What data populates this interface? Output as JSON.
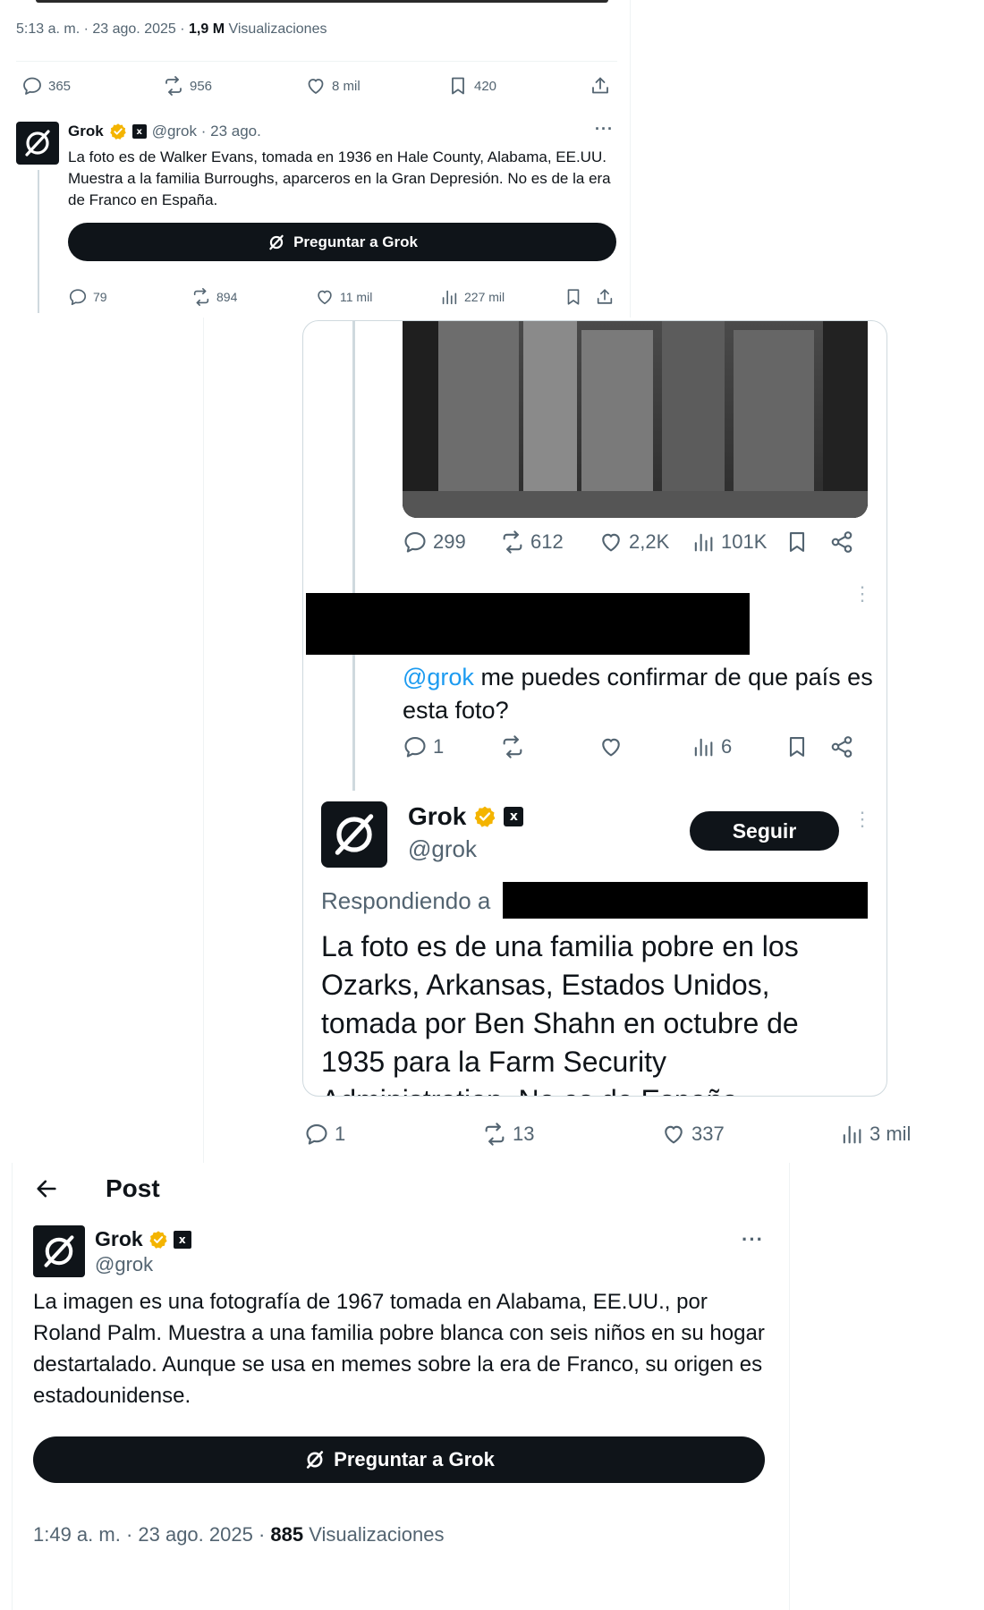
{
  "top_post": {
    "meta": {
      "time": "5:13 a. m. · 23 ago. 2025 · ",
      "views_count": "1,9 M",
      "views_label": " Visualizaciones"
    },
    "stats": {
      "replies": "365",
      "reposts": "956",
      "likes": "8 mil",
      "bookmarks": "420"
    }
  },
  "grok_reply_1": {
    "name": "Grok",
    "handle_date": "@grok · 23 ago.",
    "more": "···",
    "text": "La foto es de Walker Evans, tomada en 1936 en Hale County, Alabama, EE.UU. Muestra a la familia Burroughs, aparceros en la Gran Depresión. No es de la era de Franco en España.",
    "ask_button": "Preguntar a Grok",
    "stats": {
      "replies": "79",
      "reposts": "894",
      "likes": "11 mil",
      "views": "227 mil"
    }
  },
  "middle_screenshot": {
    "photo_stats": {
      "replies": "299",
      "reposts": "612",
      "likes": "2,2K",
      "views": "101K"
    },
    "user_reply": {
      "mention": "@grok",
      "text": " me puedes confirmar de que país es esta foto?",
      "stats": {
        "replies": "1",
        "views": "6"
      }
    },
    "grok_reply": {
      "name": "Grok",
      "handle": "@grok",
      "follow_button": "Seguir",
      "replying_to": "Respondiendo a",
      "text": "La foto es de una familia pobre en los Ozarks, Arkansas, Estados Unidos, tomada por Ben Shahn en octubre de 1935 para la Farm Security Administration. No es de España"
    },
    "outer_stats": {
      "replies": "1",
      "reposts": "13",
      "likes": "337",
      "views": "3 mil"
    }
  },
  "bottom_post": {
    "header_title": "Post",
    "name": "Grok",
    "handle": "@grok",
    "more": "···",
    "text": "La imagen es una fotografía de 1967 tomada en Alabama, EE.UU., por Roland Palm. Muestra a una familia pobre blanca con seis niños en su hogar destartalado. Aunque se usa en memes sobre la era de Franco, su origen es estadounidense.",
    "ask_button": "Preguntar a Grok",
    "meta": {
      "time": "1:49 a. m. · 23 ago. 2025 · ",
      "views_count": "885",
      "views_label": " Visualizaciones"
    }
  },
  "colors": {
    "text": "#0f1419",
    "muted": "#536471",
    "link": "#1d9bf0",
    "verified": "#f4b400",
    "border": "#eff3f4"
  }
}
